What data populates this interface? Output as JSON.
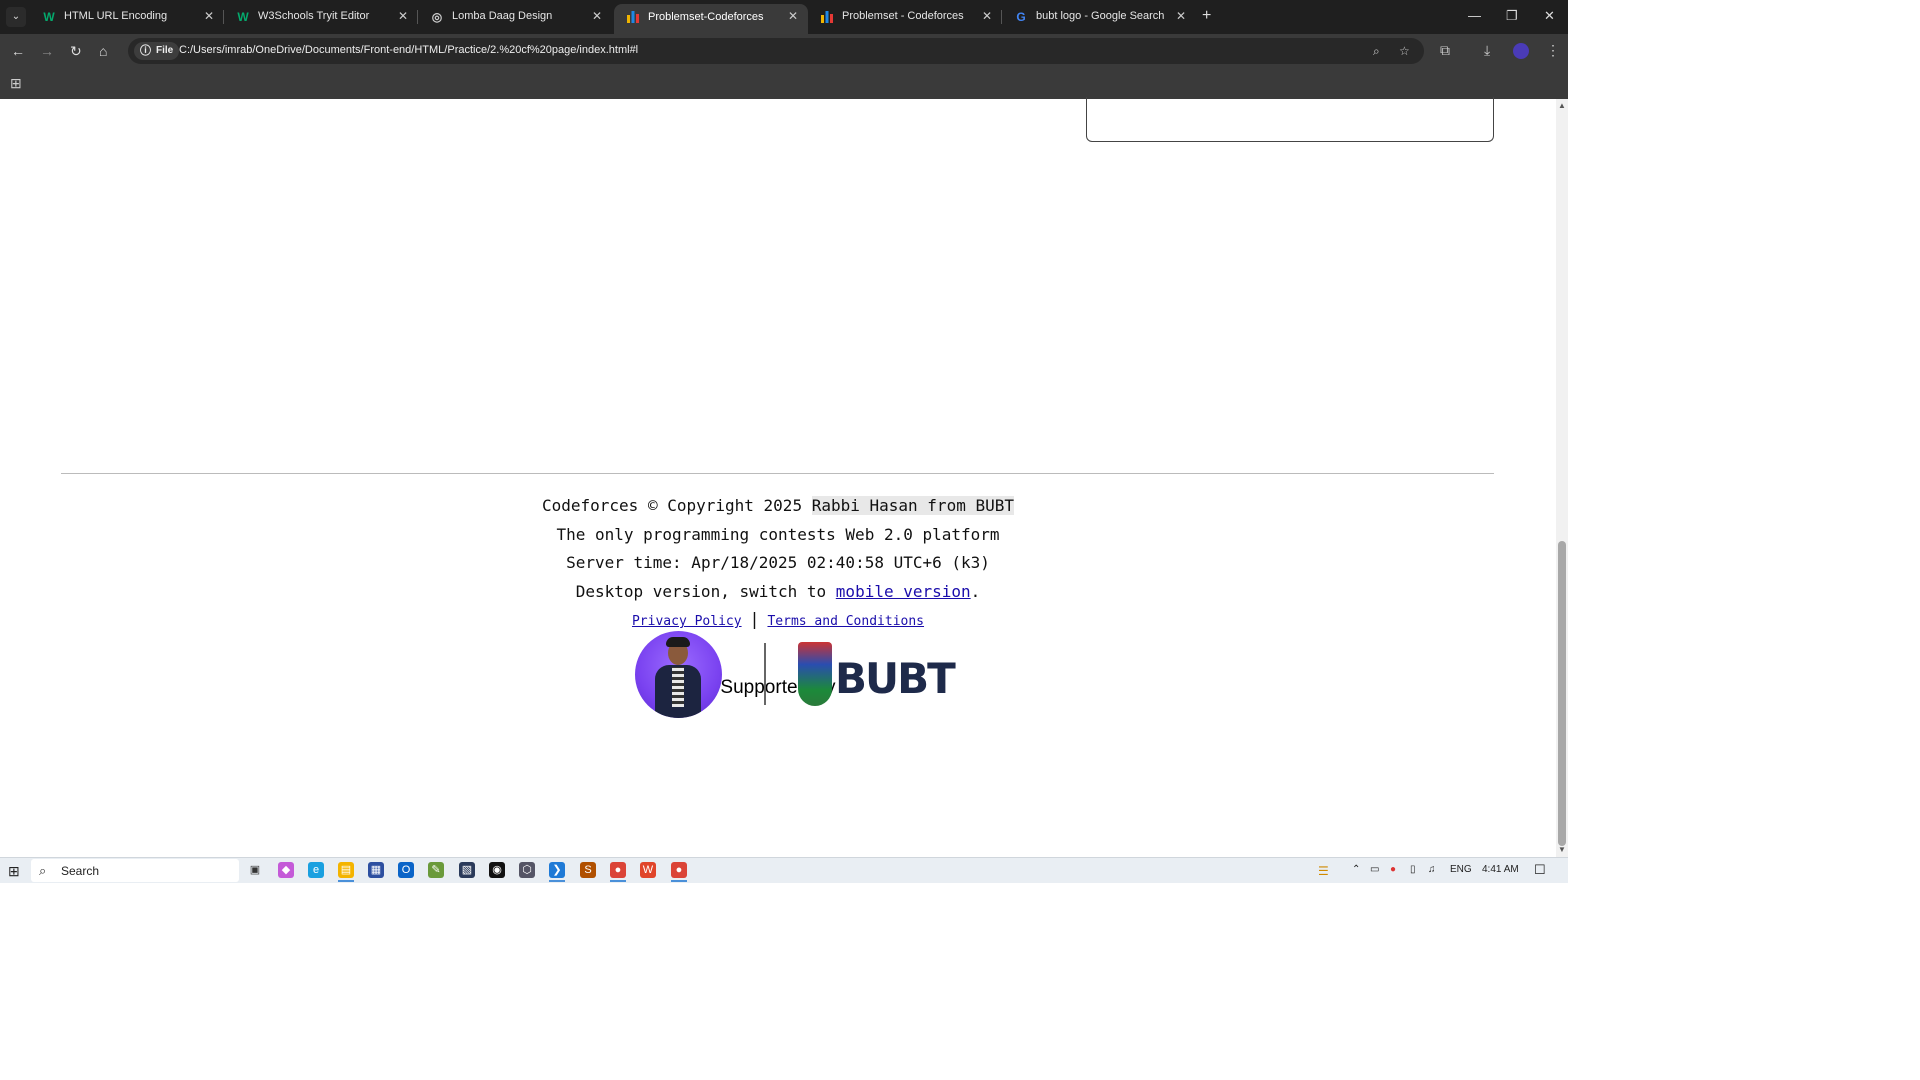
{
  "browser": {
    "tabs": [
      {
        "title": "HTML URL Encoding",
        "favicon": "W",
        "favicon_color": "#04aa6d",
        "active": false
      },
      {
        "title": "W3Schools Tryit Editor",
        "favicon": "W",
        "favicon_color": "#04aa6d",
        "active": false
      },
      {
        "title": "Lomba Daag Design",
        "favicon": "◎",
        "favicon_color": "#cccccc",
        "active": false
      },
      {
        "title": "Problemset-Codeforces",
        "favicon": "▐",
        "favicon_color": "#f0b400",
        "active": true
      },
      {
        "title": "Problemset - Codeforces",
        "favicon": "▐",
        "favicon_color": "#f0b400",
        "active": false
      },
      {
        "title": "bubt logo - Google Search",
        "favicon": "G",
        "favicon_color": "#4285f4",
        "active": false
      }
    ],
    "address": {
      "scheme_label": "File",
      "url": "C:/Users/imrab/OneDrive/Documents/Front-end/HTML/Practice/2.%20cf%20page/index.html#l"
    }
  },
  "footer": {
    "copyright_prefix": "Codeforces © Copyright 2025 ",
    "copyright_author": "Rabbi Hasan from BUBT",
    "tagline": "The only programming contests Web 2.0 platform",
    "server_time": "Server time: Apr/18/2025 02:40:58 UTC+6 (k3)",
    "desktop_prefix": "Desktop version, switch to ",
    "mobile_link": "mobile version",
    "desktop_suffix": ".",
    "privacy_link": "Privacy Policy",
    "separator": "|",
    "terms_link": "Terms and Conditions"
  },
  "supported": {
    "heading": "Supported By",
    "logo_text": "BUBT"
  },
  "taskbar": {
    "search_label": "Search",
    "language": "ENG",
    "time": "4:41 AM"
  }
}
